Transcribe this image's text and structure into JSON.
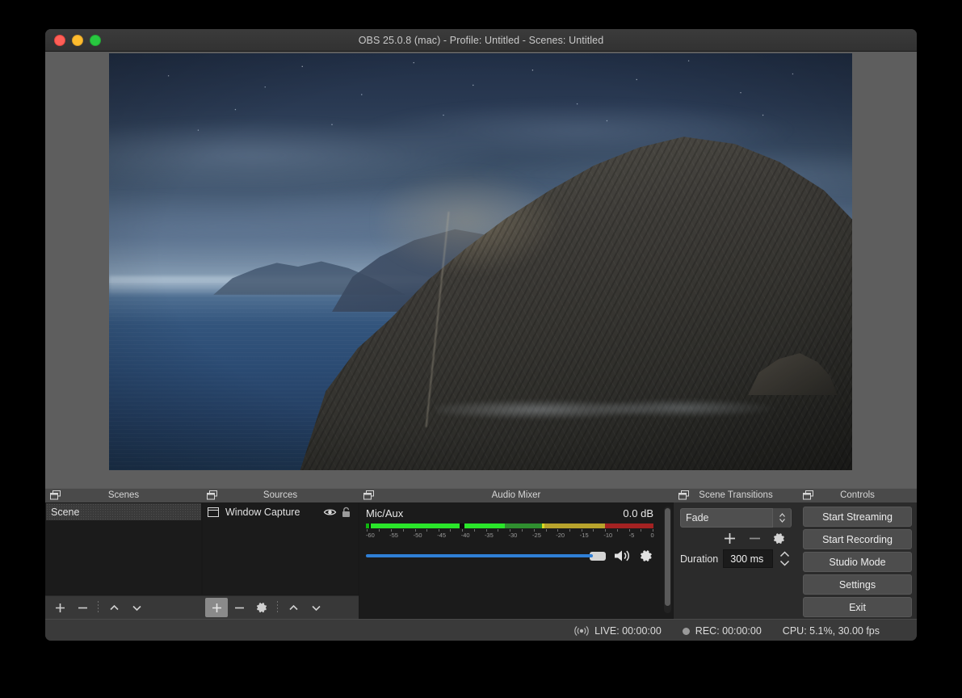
{
  "window": {
    "title": "OBS 25.0.8 (mac) - Profile: Untitled - Scenes: Untitled",
    "traffic_lights": [
      "close-button",
      "minimize-button",
      "maximize-button"
    ]
  },
  "preview": {
    "name": "preview-canvas",
    "description": "macOS Catalina night wallpaper: rocky island headland under a starry blue night sky above the sea"
  },
  "scenes": {
    "panel_title": "Scenes",
    "items": [
      {
        "label": "Scene",
        "selected": true
      }
    ],
    "toolbar": {
      "add": "+",
      "remove": "−",
      "move_up": "up-chevron",
      "move_down": "down-chevron"
    }
  },
  "sources": {
    "panel_title": "Sources",
    "items": [
      {
        "label": "Window Capture",
        "visible": true,
        "locked": false
      }
    ],
    "toolbar": {
      "add": "+",
      "remove": "−",
      "properties": "gear",
      "move_up": "up-chevron",
      "move_down": "down-chevron"
    }
  },
  "mixer": {
    "panel_title": "Audio Mixer",
    "channels": [
      {
        "name": "Mic/Aux",
        "level_db": "0.0 dB",
        "volume_percent": 100,
        "muted": false
      }
    ],
    "scale_ticks": [
      "-60",
      "-55",
      "-50",
      "-45",
      "-40",
      "-35",
      "-30",
      "-25",
      "-20",
      "-15",
      "-10",
      "-5",
      "0"
    ]
  },
  "transitions": {
    "panel_title": "Scene Transitions",
    "selected_transition": "Fade",
    "duration_label": "Duration",
    "duration_value": "300 ms",
    "buttons": {
      "add": "+",
      "remove": "−",
      "properties": "gear"
    }
  },
  "controls": {
    "panel_title": "Controls",
    "buttons": [
      "Start Streaming",
      "Start Recording",
      "Studio Mode",
      "Settings",
      "Exit"
    ]
  },
  "status": {
    "live_label": "LIVE: 00:00:00",
    "rec_label": "REC: 00:00:00",
    "cpu_label": "CPU: 5.1%, 30.00 fps"
  },
  "colors": {
    "window_chrome": "#2b2b2b",
    "panel_header": "#4a4a4a",
    "list_background": "#1b1b1b",
    "button_face": "#4d4d4d",
    "slider_accent": "#2f7fd6",
    "meter_green": "#22cc22",
    "meter_yellow": "#c8a82a",
    "meter_red": "#aa2222"
  }
}
